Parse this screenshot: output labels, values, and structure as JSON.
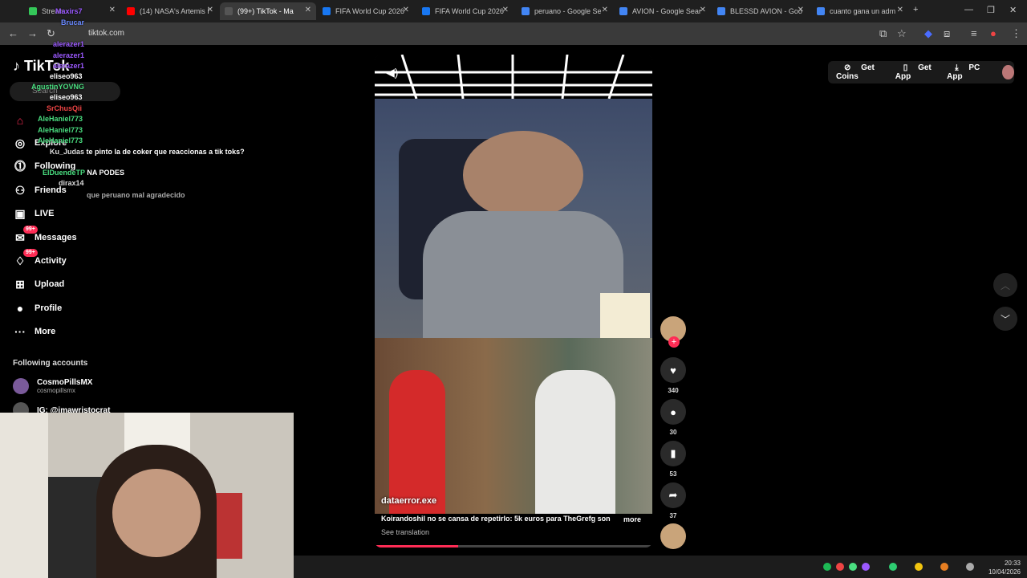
{
  "browser": {
    "tabs": [
      {
        "label": "Stream",
        "fav": "#34c759"
      },
      {
        "label": "(14) NASA's Artemis I",
        "fav": "#ff0000"
      },
      {
        "label": "(99+) TikTok - Ma",
        "fav": "#111111"
      },
      {
        "label": "FIFA World Cup 2026",
        "fav": "#1877f2"
      },
      {
        "label": "FIFA World Cup 2026",
        "fav": "#1877f2"
      },
      {
        "label": "peruano - Google Se",
        "fav": "#4285f4"
      },
      {
        "label": "AVION - Google Sear",
        "fav": "#4285f4"
      },
      {
        "label": "BLESSD AVION - Goo",
        "fav": "#4285f4"
      },
      {
        "label": "cuanto gana un adm",
        "fav": "#4285f4"
      }
    ],
    "url": "tiktok.com"
  },
  "sidebar": {
    "logo": "TikTok",
    "search_placeholder": "Search",
    "nav": [
      {
        "label": "Explore",
        "icon": "compass-icon",
        "glyph": "◎"
      },
      {
        "label": "Following",
        "icon": "following-icon",
        "glyph": "⓵"
      },
      {
        "label": "Friends",
        "icon": "friends-icon",
        "glyph": "⚇"
      },
      {
        "label": "LIVE",
        "icon": "live-icon",
        "glyph": "▣"
      },
      {
        "label": "Messages",
        "icon": "messages-icon",
        "glyph": "✉",
        "badge": "99+"
      },
      {
        "label": "Activity",
        "icon": "activity-icon",
        "glyph": "♢",
        "badge": "99+"
      },
      {
        "label": "Upload",
        "icon": "upload-icon",
        "glyph": "⊞"
      },
      {
        "label": "Profile",
        "icon": "profile-icon",
        "glyph": "●"
      },
      {
        "label": "More",
        "icon": "more-icon",
        "glyph": "···"
      }
    ],
    "following_title": "Following accounts",
    "accounts": [
      {
        "name": "CosmoPillsMX",
        "username": "cosmopillsmx"
      },
      {
        "name": "IG: @imawristocrat",
        "username": ""
      }
    ]
  },
  "chat": [
    {
      "user": "Maxirs7",
      "msg": ""
    },
    {
      "user": "Brucar",
      "msg": ""
    },
    {
      "user": "alerazer1",
      "msg": ""
    },
    {
      "user": "alerazer1",
      "msg": ""
    },
    {
      "user": "alerazer1",
      "msg": ""
    },
    {
      "user": "eliseo963",
      "msg": ""
    },
    {
      "user": "AgustinYOVNG",
      "msg": ""
    },
    {
      "user": "eliseo963",
      "msg": ""
    },
    {
      "user": "SrChusQii",
      "msg": ""
    },
    {
      "user": "AleHaniel773",
      "msg": ""
    },
    {
      "user": "AleHaniel773",
      "msg": ""
    },
    {
      "user": "AleHaniel773",
      "msg": ""
    },
    {
      "user": "Ku_Judas",
      "msg": "te pinto la de coker que reaccionas a tik toks?"
    },
    {
      "user": "ElDuendeTP",
      "msg": "NA PODES"
    },
    {
      "user": "dirax14",
      "msg": ""
    },
    {
      "user": "",
      "msg": "que peruano mal agradecido"
    }
  ],
  "video": {
    "author": "dataerror.exe",
    "caption": "Koirandoshil no se cansa de repetirlo: 5k euros para TheGrefg son",
    "more": "more",
    "translate": "See translation",
    "progress": 0.3
  },
  "actions": [
    {
      "icon": "heart-icon",
      "glyph": "♥",
      "count": "340"
    },
    {
      "icon": "comment-icon",
      "glyph": "●",
      "count": "30"
    },
    {
      "icon": "bookmark-icon",
      "glyph": "▮",
      "count": "53"
    },
    {
      "icon": "share-icon",
      "glyph": "➦",
      "count": "37"
    }
  ],
  "topright": {
    "coins": "Get Coins",
    "app": "Get App",
    "pc": "PC App"
  },
  "clock": {
    "time": "20:33",
    "date": "10/04/2026"
  }
}
